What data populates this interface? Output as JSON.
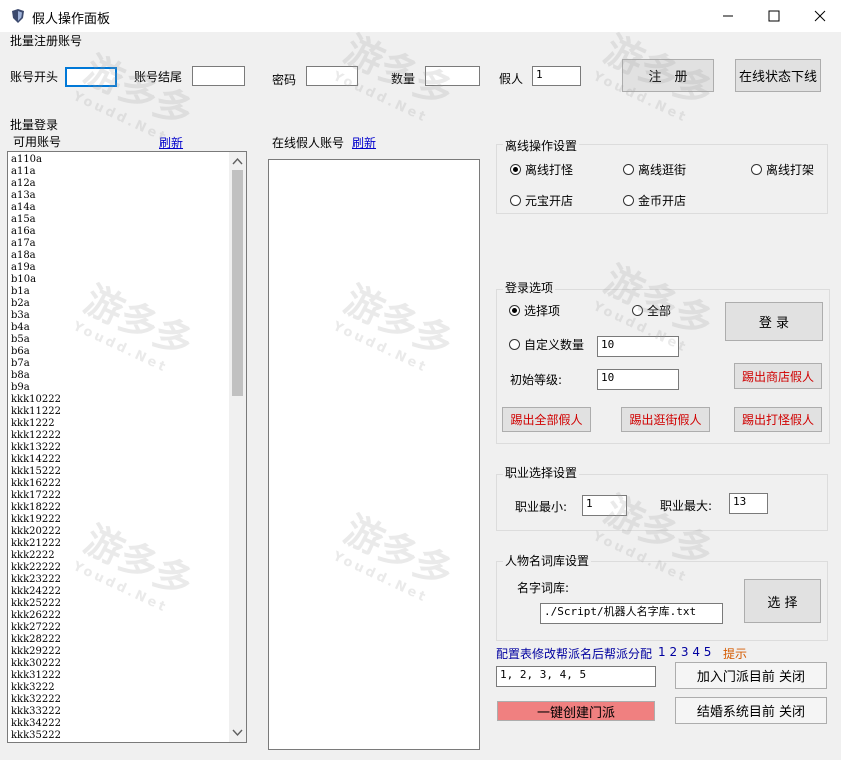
{
  "window": {
    "title": "假人操作面板"
  },
  "batch_register": {
    "section_title": "批量注册账号",
    "prefix_label": "账号开头",
    "prefix_value": "",
    "suffix_label": "账号结尾",
    "suffix_value": "",
    "password_label": "密码",
    "password_value": "",
    "count_label": "数量",
    "count_value": "",
    "fake_label": "假人",
    "fake_value": "1",
    "register_button": "注　册",
    "offline_button": "在线状态下线"
  },
  "batch_login": {
    "section_title": "批量登录",
    "available_label": "可用账号",
    "refresh_link": "刷新",
    "online_label": "在线假人账号",
    "online_refresh_link": "刷新",
    "accounts": [
      "a110a",
      "a11a",
      "a12a",
      "a13a",
      "a14a",
      "a15a",
      "a16a",
      "a17a",
      "a18a",
      "a19a",
      "b10a",
      "b1a",
      "b2a",
      "b3a",
      "b4a",
      "b5a",
      "b6a",
      "b7a",
      "b8a",
      "b9a",
      "kkk10222",
      "kkk11222",
      "kkk1222",
      "kkk12222",
      "kkk13222",
      "kkk14222",
      "kkk15222",
      "kkk16222",
      "kkk17222",
      "kkk18222",
      "kkk19222",
      "kkk20222",
      "kkk21222",
      "kkk2222",
      "kkk22222",
      "kkk23222",
      "kkk24222",
      "kkk25222",
      "kkk26222",
      "kkk27222",
      "kkk28222",
      "kkk29222",
      "kkk30222",
      "kkk31222",
      "kkk3222",
      "kkk32222",
      "kkk33222",
      "kkk34222",
      "kkk35222"
    ]
  },
  "offline_ops": {
    "title": "离线操作设置",
    "options": [
      "离线打怪",
      "离线逛街",
      "离线打架",
      "元宝开店",
      "金币开店"
    ],
    "selected": "离线打怪"
  },
  "login_options": {
    "title": "登录选项",
    "select_item": "选择项",
    "all": "全部",
    "custom_count": "自定义数量",
    "custom_count_value": "10",
    "initial_level_label": "初始等级:",
    "initial_level_value": "10",
    "login_button": "登 录",
    "kick_shop_button": "踢出商店假人",
    "kick_all_button": "踢出全部假人",
    "kick_street_button": "踢出逛街假人",
    "kick_monster_button": "踢出打怪假人"
  },
  "job_select": {
    "title": "职业选择设置",
    "min_label": "职业最小:",
    "min_value": "1",
    "max_label": "职业最大:",
    "max_value": "13"
  },
  "name_lib": {
    "title": "人物名词库设置",
    "label": "名字词库:",
    "path_value": "./Script/机器人名字库.txt",
    "select_button": "选 择"
  },
  "faction": {
    "config_text": "配置表修改帮派名后帮派分配",
    "numbers": "1 2 3 4 5",
    "hint": "提示",
    "input_value": "1, 2, 3, 4, 5",
    "join_button": "加入门派目前 关闭",
    "create_button": "一键创建门派",
    "marriage_button": "结婚系统目前 关闭"
  },
  "watermark": {
    "cn": "游多多",
    "en": "Youdd.Net"
  },
  "colors": {
    "accent_red": "#d00000",
    "link_blue": "#0000cc",
    "create_button_bg": "#f08080"
  }
}
